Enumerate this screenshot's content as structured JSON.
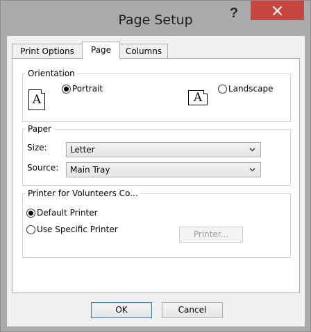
{
  "window": {
    "title": "Page Setup",
    "help_label": "?"
  },
  "tabs": [
    {
      "label": "Print Options"
    },
    {
      "label": "Page",
      "active": true
    },
    {
      "label": "Columns"
    }
  ],
  "orientation": {
    "legend": "Orientation",
    "portrait": {
      "label": "Portrait",
      "icon_letter": "A",
      "checked": true
    },
    "landscape": {
      "label": "Landscape",
      "icon_letter": "A",
      "checked": false
    }
  },
  "paper": {
    "legend": "Paper",
    "size": {
      "label": "Size:",
      "value": "Letter"
    },
    "source": {
      "label": "Source:",
      "value": "Main Tray"
    }
  },
  "printer": {
    "legend": "Printer for Volunteers Co...",
    "default_label": "Default Printer",
    "specific_label": "Use Specific Printer",
    "printer_button": "Printer...",
    "selected": "default"
  },
  "buttons": {
    "ok": "OK",
    "cancel": "Cancel"
  },
  "colors": {
    "close_button": "#c7453e",
    "frame": "#ababab"
  }
}
